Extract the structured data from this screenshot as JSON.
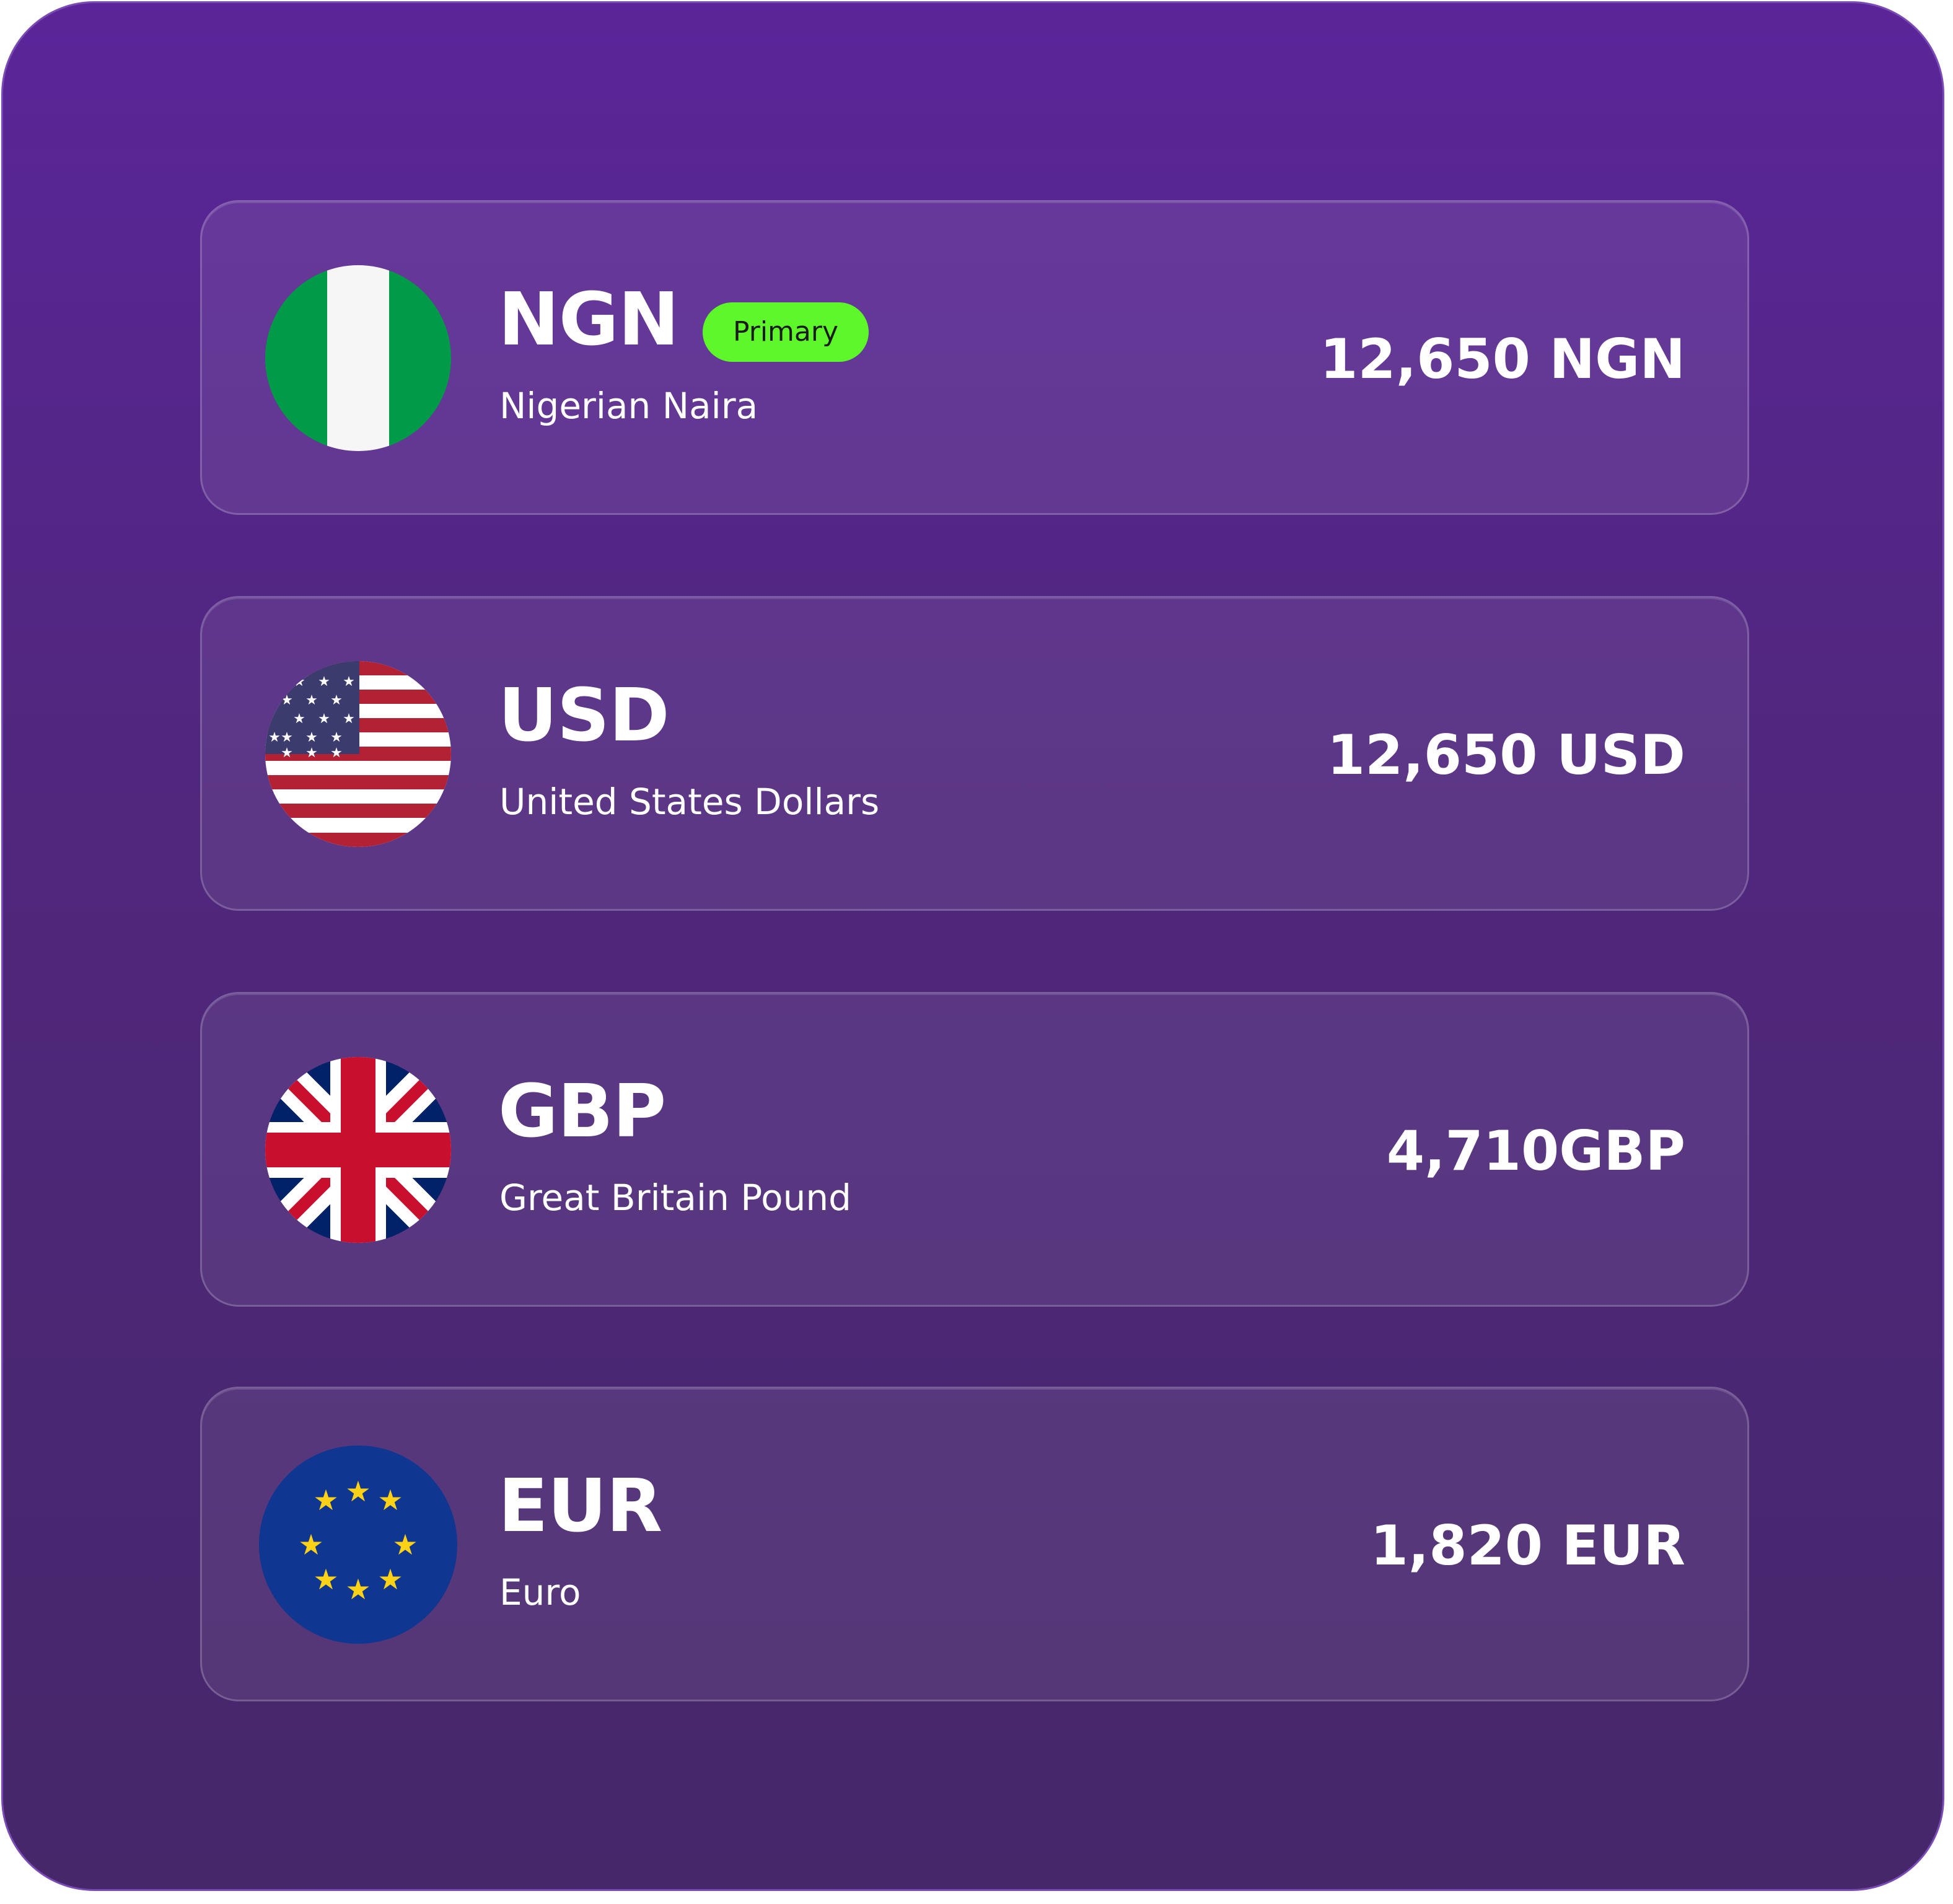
{
  "accounts": [
    {
      "code": "NGN",
      "name": "Nigerian Naira",
      "badge": "Primary",
      "amount": "12,650 NGN",
      "flag_icon": "nigeria-flag-icon"
    },
    {
      "code": "USD",
      "name": "United States Dollars",
      "amount": "12,650 USD",
      "flag_icon": "usa-flag-icon"
    },
    {
      "code": "GBP",
      "name": "Great Britain Pound",
      "amount": "4,710GBP",
      "flag_icon": "uk-flag-icon"
    },
    {
      "code": "EUR",
      "name": "Euro",
      "amount": "1,820 EUR",
      "flag_icon": "eu-flag-icon"
    }
  ],
  "colors": {
    "background_top": "#5b2599",
    "background_bottom": "#46276a",
    "badge": "#5df72a",
    "text": "#ffffff"
  }
}
